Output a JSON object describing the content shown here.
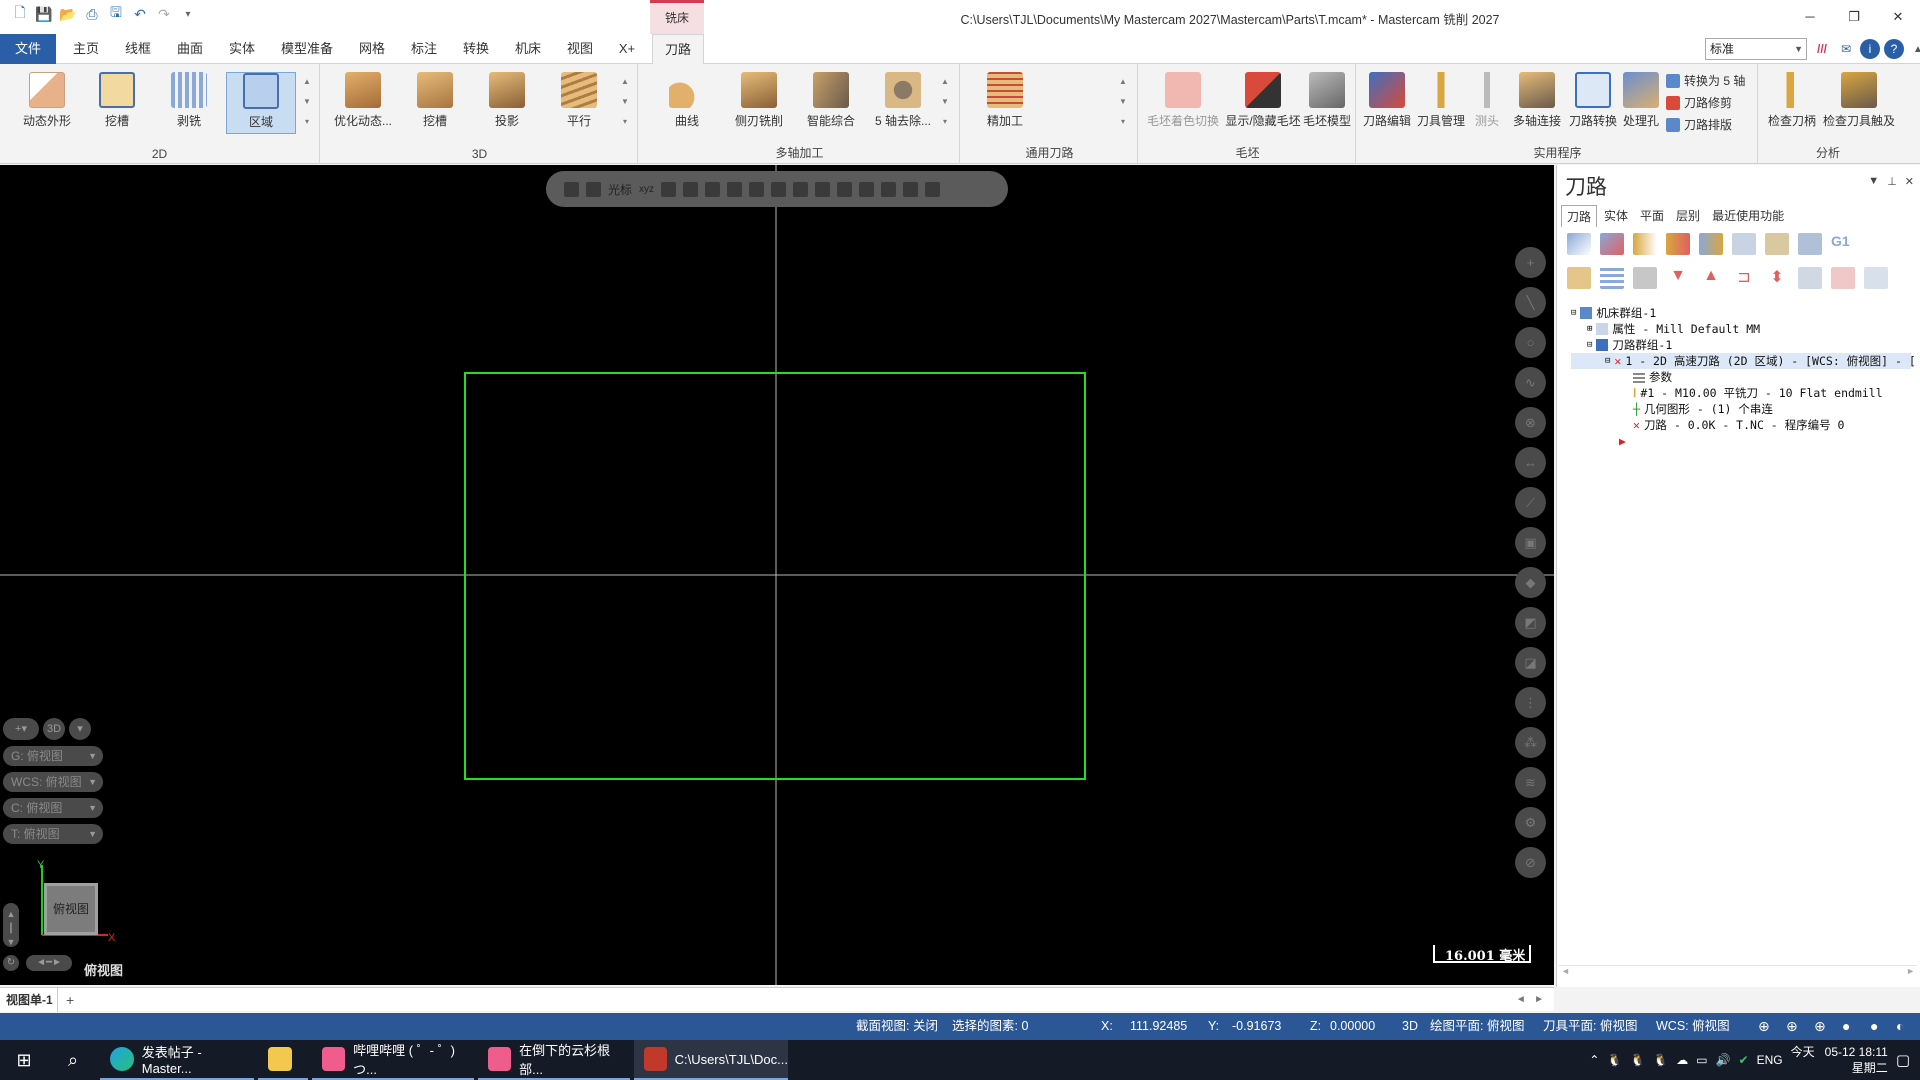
{
  "titlebar": {
    "context_tab": "铣床",
    "title": "C:\\Users\\TJL\\Documents\\My Mastercam 2027\\Mastercam\\Parts\\T.mcam* - Mastercam 铣削 2027",
    "minimize": "─",
    "restore": "❐",
    "close": "✕"
  },
  "tabs": {
    "file": "文件",
    "items": [
      "主页",
      "线框",
      "曲面",
      "实体",
      "模型准备",
      "网格",
      "标注",
      "转换",
      "机床",
      "视图",
      "X+"
    ],
    "active": "刀路"
  },
  "style_select": {
    "value": "标准"
  },
  "ribbon": {
    "group_2d": {
      "label": "2D",
      "buttons": [
        "动态外形",
        "挖槽",
        "剥铣",
        "区域"
      ]
    },
    "group_3d": {
      "label": "3D",
      "buttons": [
        "优化动态...",
        "挖槽",
        "投影",
        "平行"
      ]
    },
    "group_multiaxis": {
      "label": "多轴加工",
      "buttons": [
        "曲线",
        "侧刃铣削",
        "智能综合",
        "5 轴去除..."
      ]
    },
    "group_general": {
      "label": "通用刀路",
      "buttons": [
        "精加工"
      ]
    },
    "group_stock": {
      "label": "毛坯",
      "buttons": [
        "毛坯着色切换",
        "显示/隐藏毛坯",
        "毛坯模型"
      ]
    },
    "group_utilities": {
      "label": "实用程序",
      "buttons": [
        "刀路编辑",
        "刀具管理",
        "测头",
        "多轴连接",
        "刀路转换",
        "处理孔"
      ],
      "small": [
        "转换为 5 轴",
        "刀路修剪",
        "刀路排版"
      ]
    },
    "group_analysis": {
      "label": "分析",
      "buttons": [
        "检查刀柄",
        "检查刀具触及"
      ]
    }
  },
  "viewport": {
    "toolbar_label": "光标",
    "toolbar_coord": "xyz",
    "left_panel": {
      "mode": "3D",
      "g_view": "G: 俯视图",
      "wcs_view": "WCS: 俯视图",
      "c_view": "C: 俯视图",
      "t_view": "T: 俯视图"
    },
    "view_cube": "俯视图",
    "view_name": "俯视图",
    "axis_x": "X",
    "axis_y": "Y",
    "scale": "16.001 毫米"
  },
  "panel": {
    "title": "刀路",
    "tabs": [
      "刀路",
      "实体",
      "平面",
      "层别",
      "最近使用功能"
    ],
    "tree": [
      "机床群组-1",
      "属性 - Mill Default MM",
      "刀路群组-1",
      "1 - 2D 高速刀路 (2D 区域) - [WCS: 俯视图] - [",
      "参数",
      "#1 - M10.00 平铣刀 - 10 Flat endmill",
      "几何图形 - (1) 个串连",
      "刀路 - 0.0K - T.NC - 程序编号 0"
    ]
  },
  "sheets": {
    "tab": "视图单-1",
    "add": "+"
  },
  "status": {
    "section_view": "截面视图: 关闭",
    "selected": "选择的图素: 0",
    "x_label": "X:",
    "x_value": "111.92485",
    "y_label": "Y:",
    "y_value": "-0.91673",
    "z_label": "Z:",
    "z_value": "0.00000",
    "mode": "3D",
    "draw_plane": "绘图平面: 俯视图",
    "tool_plane": "刀具平面: 俯视图",
    "wcs": "WCS: 俯视图"
  },
  "taskbar": {
    "apps": [
      "发表帖子 - Master...",
      "哔哩哔哩 ( ゜- ゜)つ...",
      "在倒下的云杉根部...",
      "C:\\Users\\TJL\\Doc..."
    ],
    "lang": "ENG",
    "day": "今天",
    "time": "05-12 18:11",
    "weekday": "星期二"
  },
  "colors": {
    "accent": "#2a5fa8",
    "context": "#d23c53",
    "chain": "#22dd22",
    "statusbar": "#2b5797"
  }
}
